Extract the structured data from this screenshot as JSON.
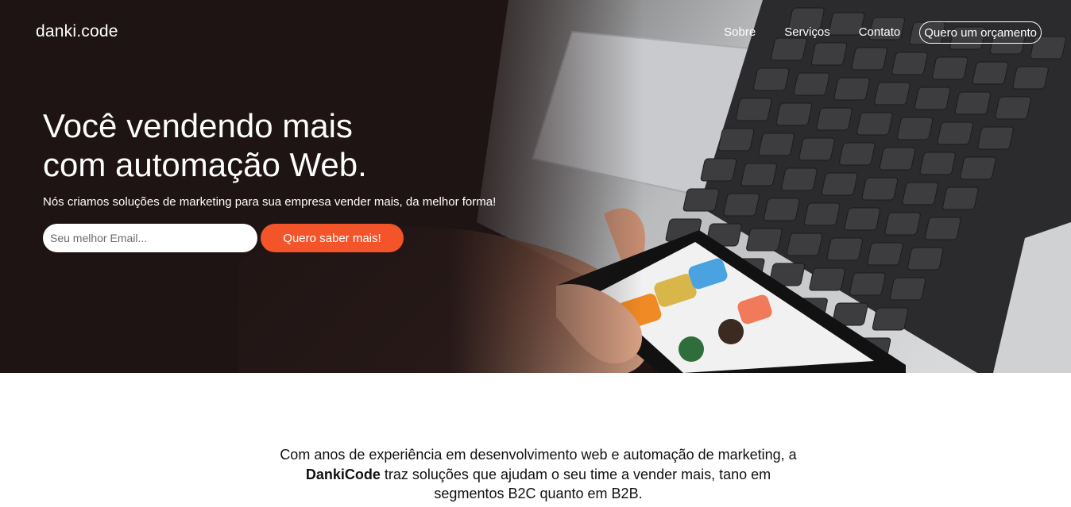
{
  "header": {
    "logo": "danki.code",
    "nav": [
      {
        "label": "Sobre"
      },
      {
        "label": "Serviços"
      },
      {
        "label": "Contato"
      }
    ],
    "quote_button": "Quero um orçamento"
  },
  "hero": {
    "headline_line1": "Você vendendo mais",
    "headline_line2": "com automação Web.",
    "subheadline": "Nós criamos soluções de marketing para sua empresa vender mais, da melhor forma!",
    "email_placeholder": "Seu melhor Email...",
    "cta_label": "Quero saber mais!"
  },
  "about": {
    "text_before": "Com anos de experiência em desenvolvimento web e automação de marketing, a ",
    "brand": "DankiCode",
    "text_after": " traz soluções que ajudam o seu time a vender mais, tano em segmentos B2C quanto em B2B."
  },
  "colors": {
    "hero_dark": "#1f1414",
    "accent": "#f4542a",
    "text": "#111111"
  }
}
